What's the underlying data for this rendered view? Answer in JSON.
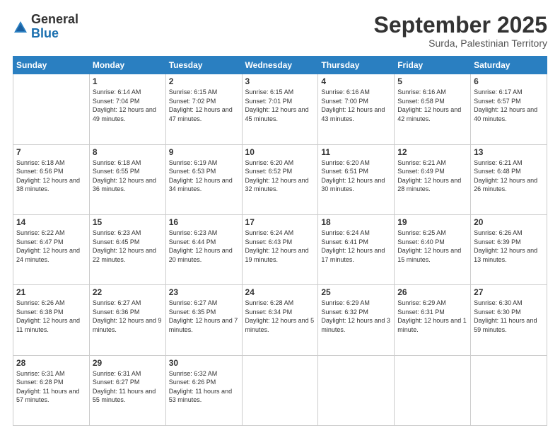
{
  "logo": {
    "general": "General",
    "blue": "Blue"
  },
  "header": {
    "month": "September 2025",
    "location": "Surda, Palestinian Territory"
  },
  "weekdays": [
    "Sunday",
    "Monday",
    "Tuesday",
    "Wednesday",
    "Thursday",
    "Friday",
    "Saturday"
  ],
  "weeks": [
    [
      {
        "day": "",
        "sunrise": "",
        "sunset": "",
        "daylight": ""
      },
      {
        "day": "1",
        "sunrise": "Sunrise: 6:14 AM",
        "sunset": "Sunset: 7:04 PM",
        "daylight": "Daylight: 12 hours and 49 minutes."
      },
      {
        "day": "2",
        "sunrise": "Sunrise: 6:15 AM",
        "sunset": "Sunset: 7:02 PM",
        "daylight": "Daylight: 12 hours and 47 minutes."
      },
      {
        "day": "3",
        "sunrise": "Sunrise: 6:15 AM",
        "sunset": "Sunset: 7:01 PM",
        "daylight": "Daylight: 12 hours and 45 minutes."
      },
      {
        "day": "4",
        "sunrise": "Sunrise: 6:16 AM",
        "sunset": "Sunset: 7:00 PM",
        "daylight": "Daylight: 12 hours and 43 minutes."
      },
      {
        "day": "5",
        "sunrise": "Sunrise: 6:16 AM",
        "sunset": "Sunset: 6:58 PM",
        "daylight": "Daylight: 12 hours and 42 minutes."
      },
      {
        "day": "6",
        "sunrise": "Sunrise: 6:17 AM",
        "sunset": "Sunset: 6:57 PM",
        "daylight": "Daylight: 12 hours and 40 minutes."
      }
    ],
    [
      {
        "day": "7",
        "sunrise": "Sunrise: 6:18 AM",
        "sunset": "Sunset: 6:56 PM",
        "daylight": "Daylight: 12 hours and 38 minutes."
      },
      {
        "day": "8",
        "sunrise": "Sunrise: 6:18 AM",
        "sunset": "Sunset: 6:55 PM",
        "daylight": "Daylight: 12 hours and 36 minutes."
      },
      {
        "day": "9",
        "sunrise": "Sunrise: 6:19 AM",
        "sunset": "Sunset: 6:53 PM",
        "daylight": "Daylight: 12 hours and 34 minutes."
      },
      {
        "day": "10",
        "sunrise": "Sunrise: 6:20 AM",
        "sunset": "Sunset: 6:52 PM",
        "daylight": "Daylight: 12 hours and 32 minutes."
      },
      {
        "day": "11",
        "sunrise": "Sunrise: 6:20 AM",
        "sunset": "Sunset: 6:51 PM",
        "daylight": "Daylight: 12 hours and 30 minutes."
      },
      {
        "day": "12",
        "sunrise": "Sunrise: 6:21 AM",
        "sunset": "Sunset: 6:49 PM",
        "daylight": "Daylight: 12 hours and 28 minutes."
      },
      {
        "day": "13",
        "sunrise": "Sunrise: 6:21 AM",
        "sunset": "Sunset: 6:48 PM",
        "daylight": "Daylight: 12 hours and 26 minutes."
      }
    ],
    [
      {
        "day": "14",
        "sunrise": "Sunrise: 6:22 AM",
        "sunset": "Sunset: 6:47 PM",
        "daylight": "Daylight: 12 hours and 24 minutes."
      },
      {
        "day": "15",
        "sunrise": "Sunrise: 6:23 AM",
        "sunset": "Sunset: 6:45 PM",
        "daylight": "Daylight: 12 hours and 22 minutes."
      },
      {
        "day": "16",
        "sunrise": "Sunrise: 6:23 AM",
        "sunset": "Sunset: 6:44 PM",
        "daylight": "Daylight: 12 hours and 20 minutes."
      },
      {
        "day": "17",
        "sunrise": "Sunrise: 6:24 AM",
        "sunset": "Sunset: 6:43 PM",
        "daylight": "Daylight: 12 hours and 19 minutes."
      },
      {
        "day": "18",
        "sunrise": "Sunrise: 6:24 AM",
        "sunset": "Sunset: 6:41 PM",
        "daylight": "Daylight: 12 hours and 17 minutes."
      },
      {
        "day": "19",
        "sunrise": "Sunrise: 6:25 AM",
        "sunset": "Sunset: 6:40 PM",
        "daylight": "Daylight: 12 hours and 15 minutes."
      },
      {
        "day": "20",
        "sunrise": "Sunrise: 6:26 AM",
        "sunset": "Sunset: 6:39 PM",
        "daylight": "Daylight: 12 hours and 13 minutes."
      }
    ],
    [
      {
        "day": "21",
        "sunrise": "Sunrise: 6:26 AM",
        "sunset": "Sunset: 6:38 PM",
        "daylight": "Daylight: 12 hours and 11 minutes."
      },
      {
        "day": "22",
        "sunrise": "Sunrise: 6:27 AM",
        "sunset": "Sunset: 6:36 PM",
        "daylight": "Daylight: 12 hours and 9 minutes."
      },
      {
        "day": "23",
        "sunrise": "Sunrise: 6:27 AM",
        "sunset": "Sunset: 6:35 PM",
        "daylight": "Daylight: 12 hours and 7 minutes."
      },
      {
        "day": "24",
        "sunrise": "Sunrise: 6:28 AM",
        "sunset": "Sunset: 6:34 PM",
        "daylight": "Daylight: 12 hours and 5 minutes."
      },
      {
        "day": "25",
        "sunrise": "Sunrise: 6:29 AM",
        "sunset": "Sunset: 6:32 PM",
        "daylight": "Daylight: 12 hours and 3 minutes."
      },
      {
        "day": "26",
        "sunrise": "Sunrise: 6:29 AM",
        "sunset": "Sunset: 6:31 PM",
        "daylight": "Daylight: 12 hours and 1 minute."
      },
      {
        "day": "27",
        "sunrise": "Sunrise: 6:30 AM",
        "sunset": "Sunset: 6:30 PM",
        "daylight": "Daylight: 11 hours and 59 minutes."
      }
    ],
    [
      {
        "day": "28",
        "sunrise": "Sunrise: 6:31 AM",
        "sunset": "Sunset: 6:28 PM",
        "daylight": "Daylight: 11 hours and 57 minutes."
      },
      {
        "day": "29",
        "sunrise": "Sunrise: 6:31 AM",
        "sunset": "Sunset: 6:27 PM",
        "daylight": "Daylight: 11 hours and 55 minutes."
      },
      {
        "day": "30",
        "sunrise": "Sunrise: 6:32 AM",
        "sunset": "Sunset: 6:26 PM",
        "daylight": "Daylight: 11 hours and 53 minutes."
      },
      {
        "day": "",
        "sunrise": "",
        "sunset": "",
        "daylight": ""
      },
      {
        "day": "",
        "sunrise": "",
        "sunset": "",
        "daylight": ""
      },
      {
        "day": "",
        "sunrise": "",
        "sunset": "",
        "daylight": ""
      },
      {
        "day": "",
        "sunrise": "",
        "sunset": "",
        "daylight": ""
      }
    ]
  ]
}
